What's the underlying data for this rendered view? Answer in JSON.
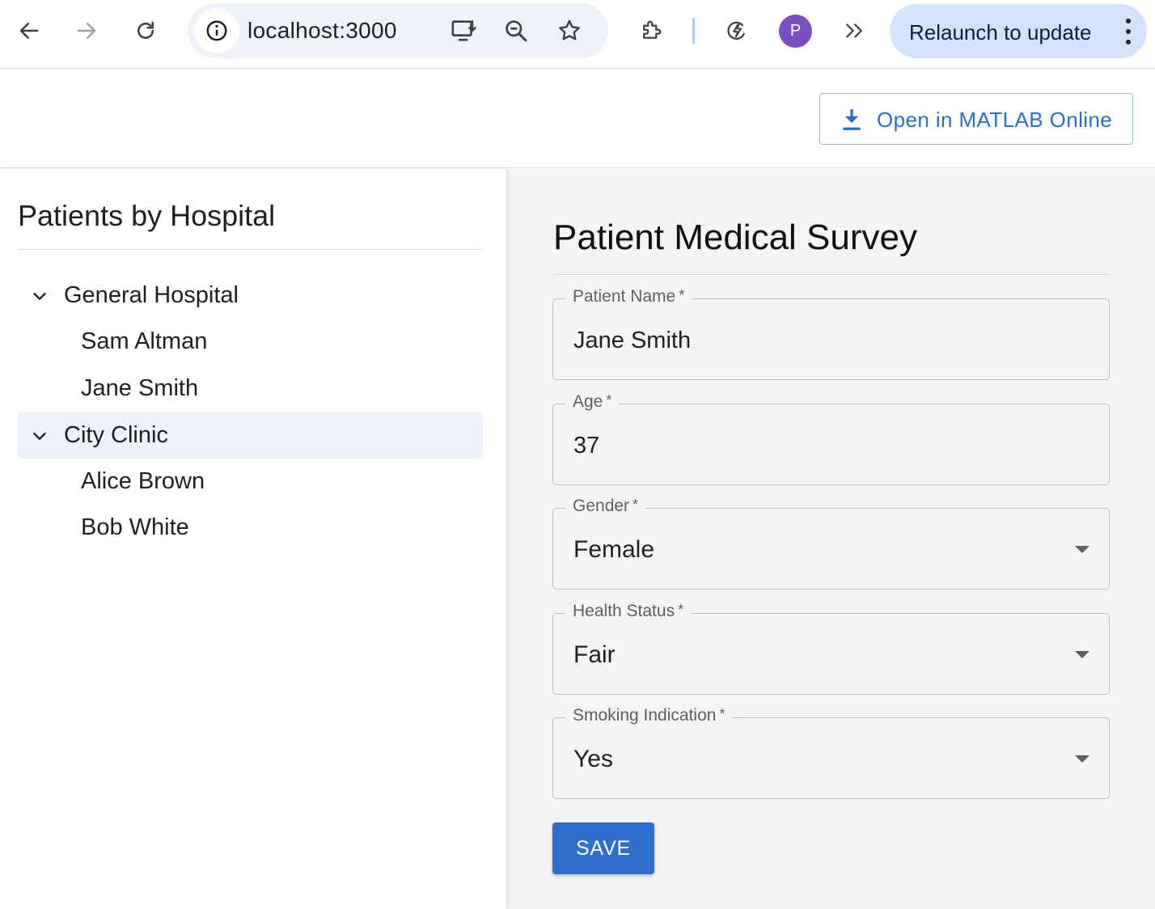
{
  "browser": {
    "url": "localhost:3000",
    "profile_initial": "P",
    "relaunch_label": "Relaunch to update",
    "icons": [
      "back-arrow-icon",
      "forward-arrow-icon",
      "reload-icon",
      "site-info-icon",
      "install-app-icon",
      "zoom-icon",
      "bookmark-star-icon",
      "extensions-icon",
      "performance-icon",
      "more-tools-icon",
      "menu-kebab-icon"
    ]
  },
  "header": {
    "matlab_button_label": "Open in MATLAB Online"
  },
  "sidebar": {
    "title": "Patients by Hospital",
    "groups": [
      {
        "label": "General Hospital",
        "expanded": true,
        "selected": false,
        "children": [
          "Sam Altman",
          "Jane Smith"
        ]
      },
      {
        "label": "City Clinic",
        "expanded": true,
        "selected": true,
        "children": [
          "Alice Brown",
          "Bob White"
        ]
      }
    ]
  },
  "form": {
    "title": "Patient Medical Survey",
    "required_mark": "*",
    "fields": [
      {
        "label": "Patient Name",
        "value": "Jane Smith",
        "type": "text"
      },
      {
        "label": "Age",
        "value": "37",
        "type": "text"
      },
      {
        "label": "Gender",
        "value": "Female",
        "type": "select"
      },
      {
        "label": "Health Status",
        "value": "Fair",
        "type": "select"
      },
      {
        "label": "Smoking Indication",
        "value": "Yes",
        "type": "select"
      }
    ],
    "save_label": "SAVE"
  },
  "colors": {
    "accent": "#2f6ecc",
    "selected_row": "#edf2fa",
    "relaunch_bg": "#d3e3fd",
    "avatar": "#7a4fc0"
  }
}
